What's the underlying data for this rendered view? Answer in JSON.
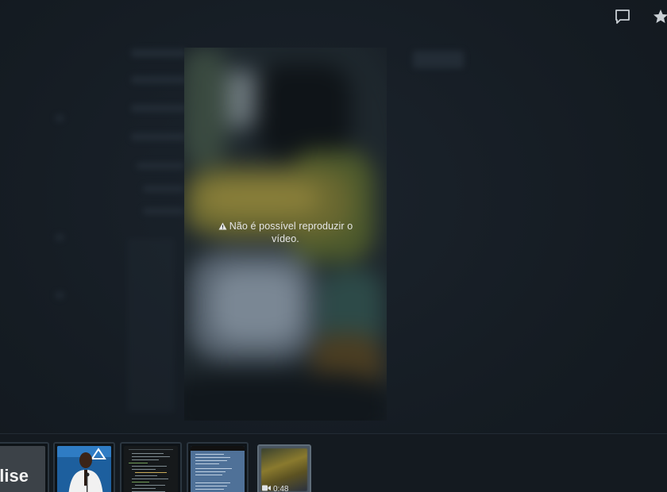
{
  "video": {
    "error_message": "Não é possível reproduzir o vídeo."
  },
  "header": {
    "icons": [
      "comment-icon",
      "star-icon"
    ]
  },
  "filmstrip": {
    "thumbnails": [
      {
        "kind": "text-image",
        "text": "alise"
      },
      {
        "kind": "photo"
      },
      {
        "kind": "code-screenshot"
      },
      {
        "kind": "phone-screenshot"
      },
      {
        "kind": "video",
        "duration": "0:48",
        "selected": true
      }
    ]
  },
  "colors": {
    "background": "#161d25",
    "active_thumb_border": "#5f6d79",
    "text": "#e6e6e6"
  }
}
